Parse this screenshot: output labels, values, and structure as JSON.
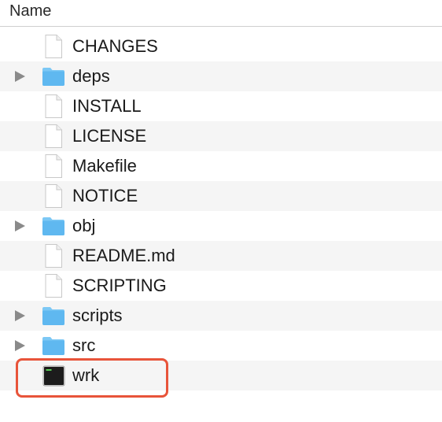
{
  "header": {
    "name_label": "Name"
  },
  "files": [
    {
      "name": "CHANGES",
      "kind": "file"
    },
    {
      "name": "deps",
      "kind": "folder"
    },
    {
      "name": "INSTALL",
      "kind": "file"
    },
    {
      "name": "LICENSE",
      "kind": "file"
    },
    {
      "name": "Makefile",
      "kind": "file"
    },
    {
      "name": "NOTICE",
      "kind": "file"
    },
    {
      "name": "obj",
      "kind": "folder"
    },
    {
      "name": "README.md",
      "kind": "file"
    },
    {
      "name": "SCRIPTING",
      "kind": "file"
    },
    {
      "name": "scripts",
      "kind": "folder"
    },
    {
      "name": "src",
      "kind": "folder"
    },
    {
      "name": "wrk",
      "kind": "executable"
    }
  ],
  "highlighted_item": "wrk",
  "colors": {
    "folder": "#5fb8f0",
    "folder_tab": "#7cc8f5",
    "disclosure": "#8a8a8a",
    "highlight_border": "#e8543a",
    "terminal_bg": "#1c1c1c",
    "terminal_text": "#5ee05e"
  },
  "icons": {
    "file": "document-icon",
    "folder": "folder-icon",
    "executable": "terminal-executable-icon",
    "disclosure": "disclosure-triangle-icon"
  }
}
